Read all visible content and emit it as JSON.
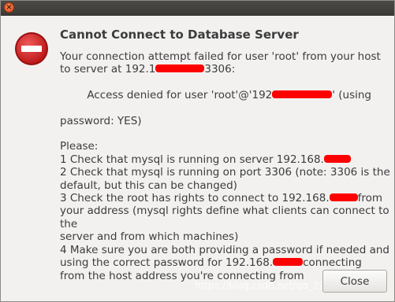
{
  "window": {
    "close_glyph": "×"
  },
  "dialog": {
    "icon": "error-icon",
    "title": "Cannot Connect to Database Server",
    "lines": {
      "l1": "Your connection attempt failed for user 'root' from your host",
      "l2a": "to server at 192.1",
      "l2b": "3306:",
      "l3a": "  Access denied for user 'root'@'192",
      "l3b": "' (using",
      "l4": "password: YES)",
      "please": "Please:",
      "s1a": "1 Check that mysql is running on server 192.168.",
      "s2a": "2 Check that mysql is running on port 3306 (note: 3306 is the",
      "s2b": "default, but this can be changed)",
      "s3a": "3 Check the root has rights to connect to 192.168.",
      "s3b": "from",
      "s3c": "your address (mysql rights define what clients can connect to the",
      "s3d": "server and from which machines)",
      "s4a": "4 Make sure you are both providing a password if needed and",
      "s4b": "using the correct password for 192.168.",
      "s4c": "connecting",
      "s4d": "from the host address you're connecting from"
    },
    "close_label": "Close"
  },
  "watermark": "https://blog.csdn.net/qq_29166327",
  "colors": {
    "redaction": "#ff0000",
    "icon_red": "#d01f1f",
    "titlebar": "#3c3b37"
  }
}
